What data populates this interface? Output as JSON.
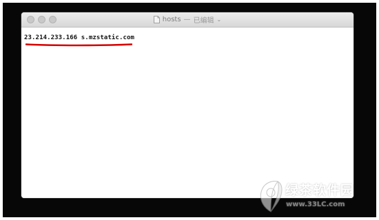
{
  "window": {
    "title": "hosts",
    "title_separator": "—",
    "title_status": "已编辑",
    "chevron_glyph": "⌄"
  },
  "editor": {
    "lines": [
      "23.214.233.166 s.mzstatic.com"
    ],
    "highlight_color": "#d40000"
  },
  "watermark": {
    "text": "绿茶软件园",
    "url": "www.33LC.com"
  }
}
